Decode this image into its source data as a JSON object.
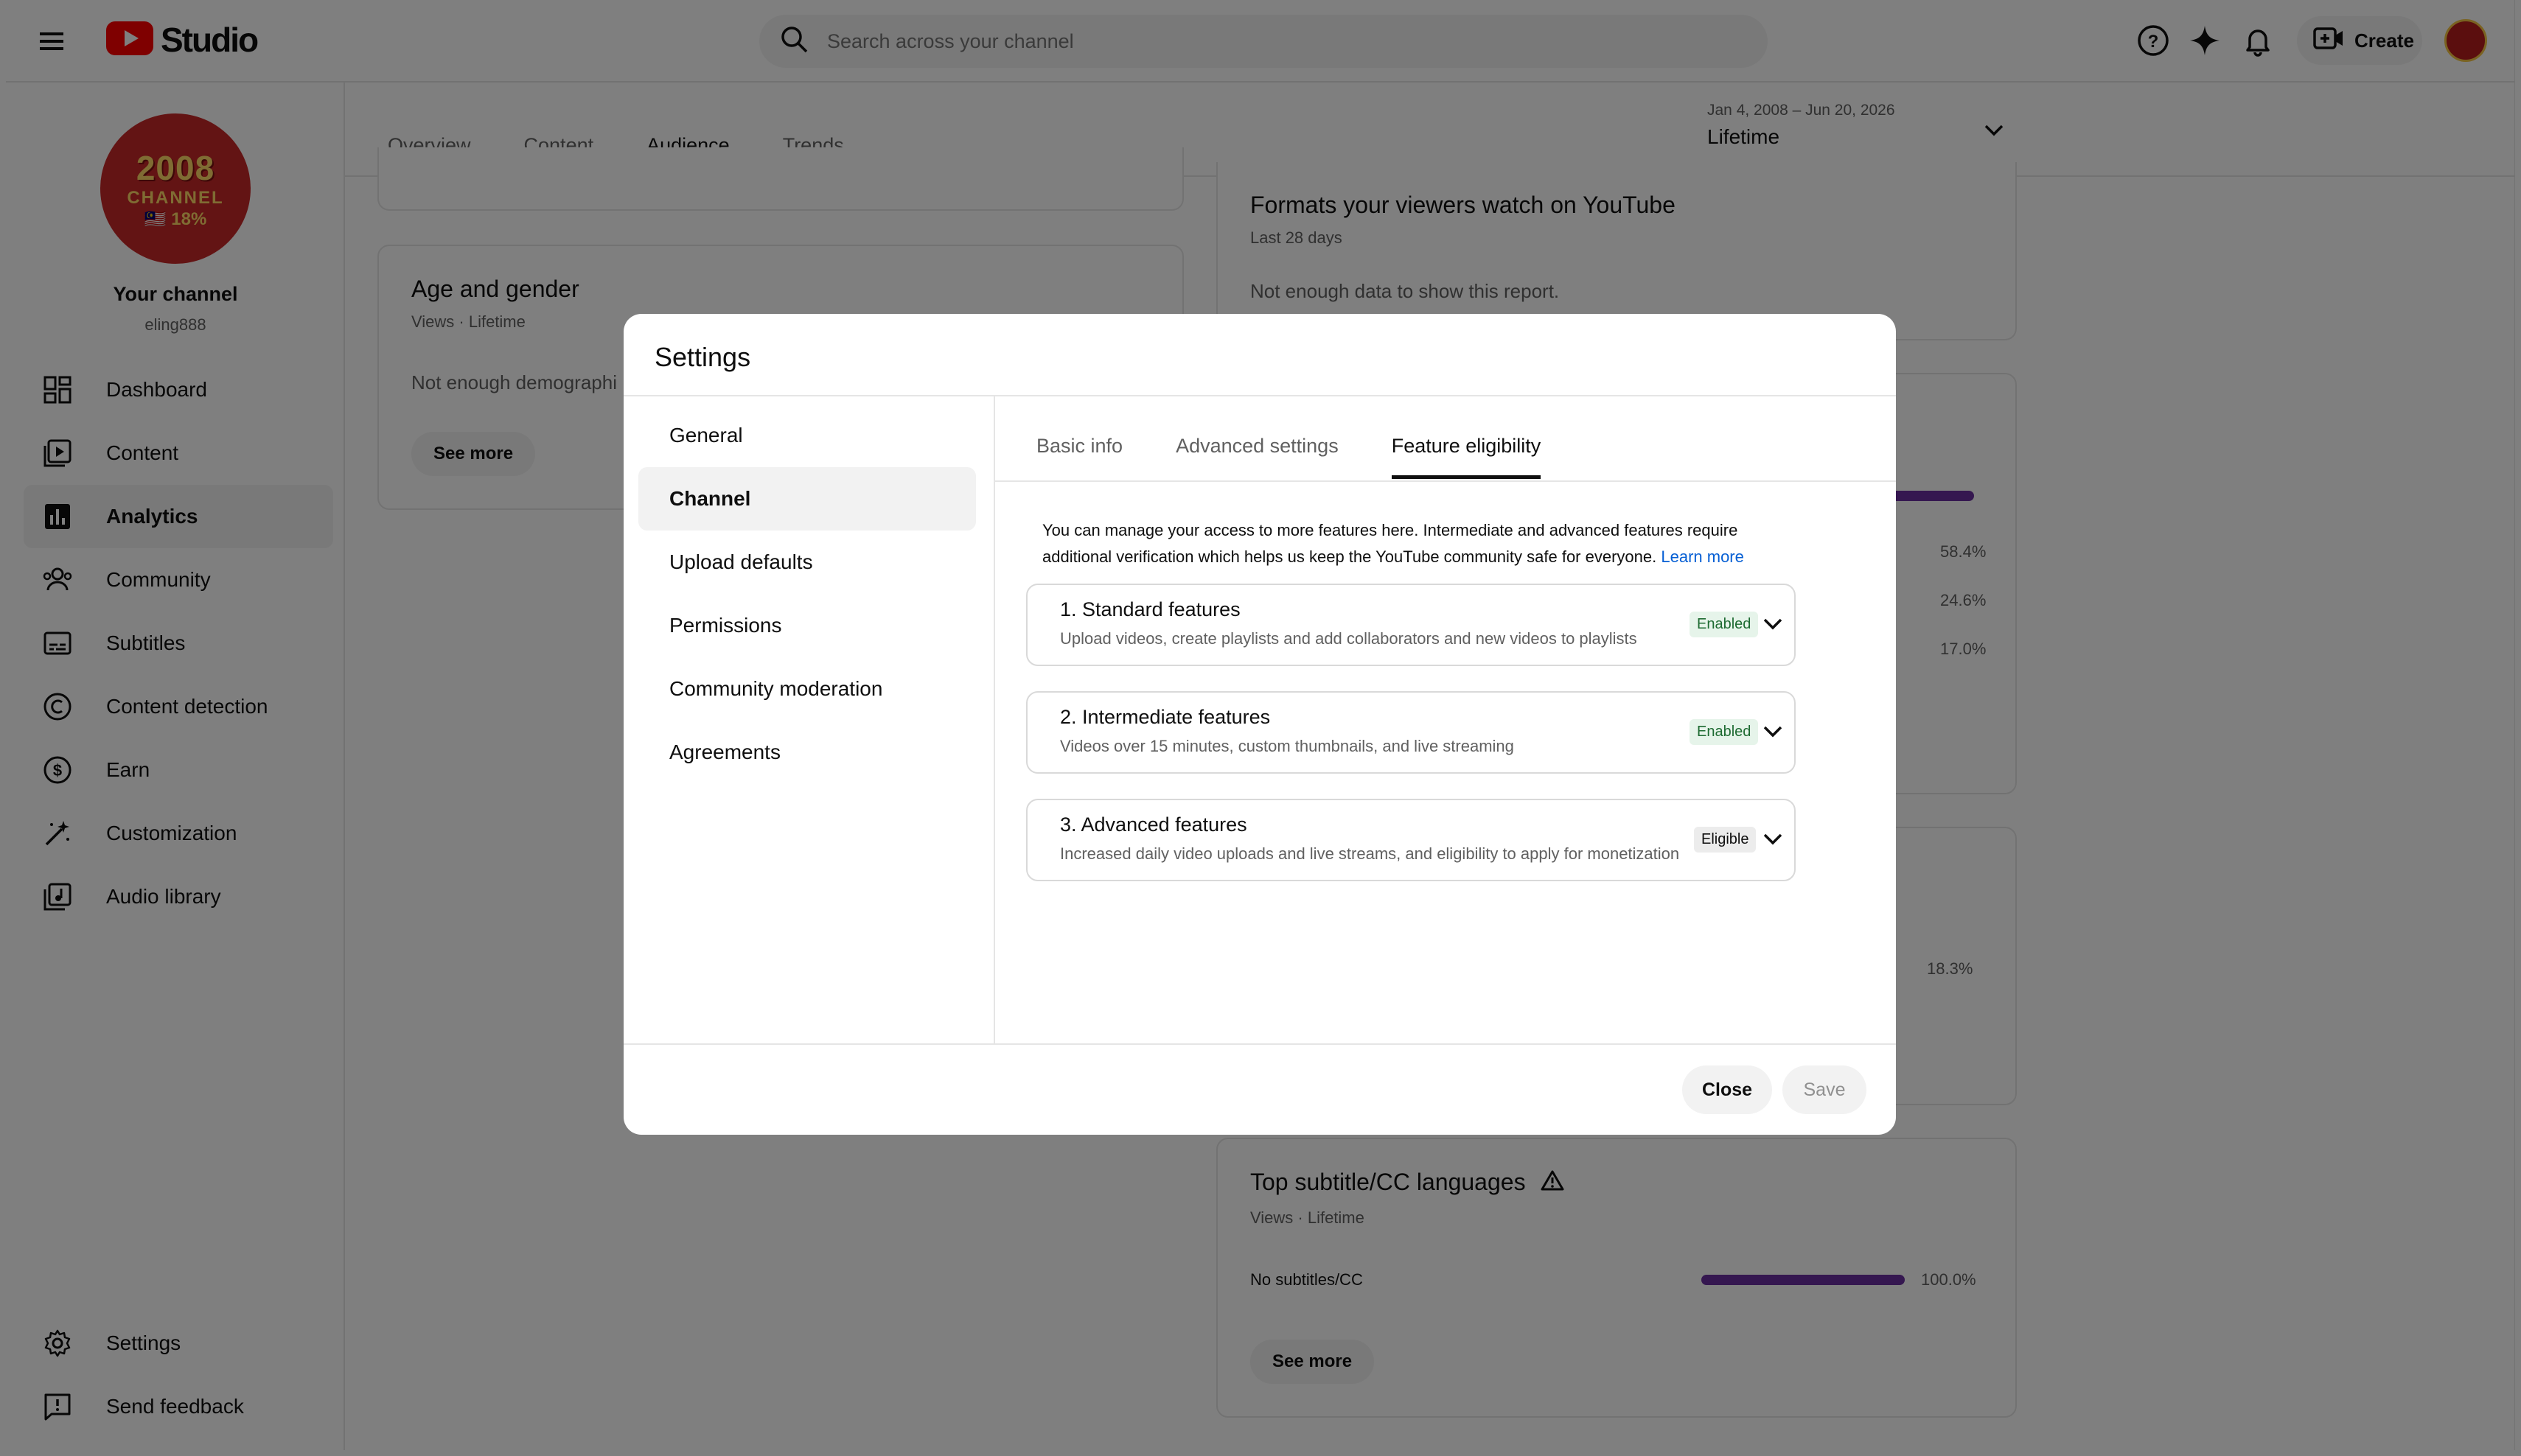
{
  "header": {
    "logo_text": "Studio",
    "search_placeholder": "Search across your channel",
    "create_label": "Create"
  },
  "sidebar": {
    "channel_name": "Your channel",
    "channel_handle": "eling888",
    "avatar_text": [
      "2008",
      "CHANNEL",
      "🇲🇾 18%"
    ],
    "items": [
      {
        "label": "Dashboard",
        "icon": "dashboard-icon"
      },
      {
        "label": "Content",
        "icon": "content-icon"
      },
      {
        "label": "Analytics",
        "icon": "analytics-icon",
        "active": true
      },
      {
        "label": "Community",
        "icon": "community-icon"
      },
      {
        "label": "Subtitles",
        "icon": "subtitles-icon"
      },
      {
        "label": "Content detection",
        "icon": "copyright-icon"
      },
      {
        "label": "Earn",
        "icon": "dollar-icon"
      },
      {
        "label": "Customization",
        "icon": "magic-wand-icon"
      },
      {
        "label": "Audio library",
        "icon": "audio-library-icon"
      }
    ],
    "bottom_items": [
      {
        "label": "Settings",
        "icon": "gear-icon"
      },
      {
        "label": "Send feedback",
        "icon": "feedback-icon"
      }
    ]
  },
  "main": {
    "tabs": [
      {
        "label": "Overview"
      },
      {
        "label": "Content"
      },
      {
        "label": "Audience",
        "active": true
      },
      {
        "label": "Trends"
      }
    ],
    "date_range": {
      "range": "Jan 4, 2008 – Jun 20, 2026",
      "label": "Lifetime"
    },
    "age_gender": {
      "title": "Age and gender",
      "subtitle": "Views · Lifetime",
      "message": "Not enough demographi",
      "see_more": "See more"
    },
    "formats": {
      "title": "Formats your viewers watch on YouTube",
      "subtitle": "Last 28 days",
      "message": "Not enough data to show this report."
    },
    "bg_percents": [
      "58.4%",
      "24.6%",
      "17.0%",
      "18.3%"
    ],
    "subtitle_langs": {
      "title": "Top subtitle/CC languages",
      "subtitle": "Views · Lifetime",
      "row_label": "No subtitles/CC",
      "row_value": "100.0%",
      "row_fraction": 1.0,
      "see_more": "See more"
    }
  },
  "modal": {
    "title": "Settings",
    "nav": [
      {
        "label": "General"
      },
      {
        "label": "Channel",
        "active": true
      },
      {
        "label": "Upload defaults"
      },
      {
        "label": "Permissions"
      },
      {
        "label": "Community moderation"
      },
      {
        "label": "Agreements"
      }
    ],
    "tabs": [
      {
        "label": "Basic info"
      },
      {
        "label": "Advanced settings"
      },
      {
        "label": "Feature eligibility",
        "active": true
      }
    ],
    "intro_text": "You can manage your access to more features here. Intermediate and advanced features require additional verification which helps us keep the YouTube community safe for everyone.",
    "learn_more": "Learn more",
    "features": [
      {
        "title": "1. Standard features",
        "desc": "Upload videos, create playlists and add collaborators and new videos to playlists",
        "status": "Enabled"
      },
      {
        "title": "2. Intermediate features",
        "desc": "Videos over 15 minutes, custom thumbnails, and live streaming",
        "status": "Enabled"
      },
      {
        "title": "3. Advanced features",
        "desc": "Increased daily video uploads and live streams, and eligibility to apply for monetization",
        "status": "Eligible"
      }
    ],
    "close_label": "Close",
    "save_label": "Save"
  },
  "colors": {
    "accent_purple": "#6b2fa0",
    "link_blue": "#065fd4",
    "enabled_green": "#1e6b32",
    "brand_red": "#ff0000"
  }
}
